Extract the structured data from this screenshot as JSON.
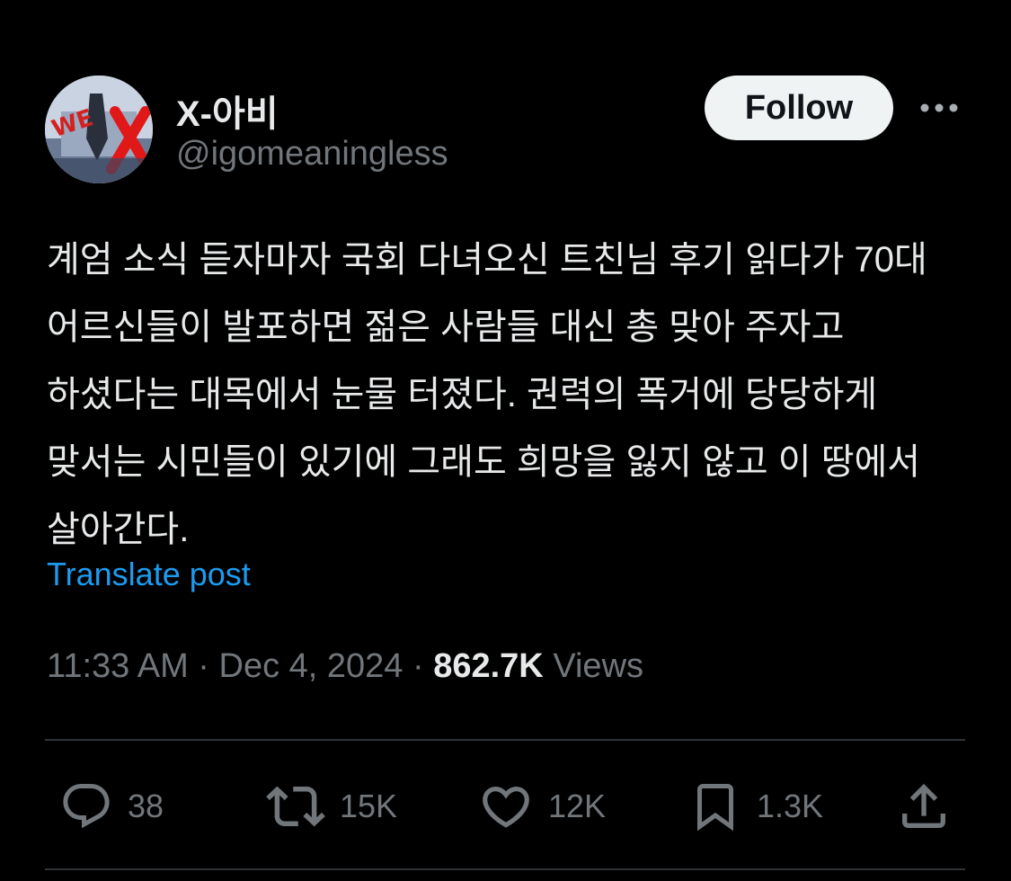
{
  "author": {
    "display_name": "X-아비",
    "handle": "@igomeaningless",
    "avatar_icon": "profile-avatar-image"
  },
  "header": {
    "follow_label": "Follow",
    "more_icon": "more-options-icon"
  },
  "post": {
    "text": "계엄 소식 듣자마자 국회 다녀오신 트친님 후기 읽다가 70대 어르신들이 발포하면 젊은 사람들 대신 총 맞아 주자고 하셨다는 대목에서 눈물 터졌다. 권력의 폭거에 당당하게 맞서는 시민들이 있기에 그래도 희망을 잃지 않고 이 땅에서 살아간다.",
    "translate_label": "Translate post"
  },
  "meta": {
    "time": "11:33 AM",
    "separator": "·",
    "date": "Dec 4, 2024",
    "views_count": "862.7K",
    "views_label": "Views"
  },
  "actions": {
    "replies": "38",
    "reposts": "15K",
    "likes": "12K",
    "bookmarks": "1.3K"
  },
  "colors": {
    "background": "#000000",
    "primary_text": "#e7e9ea",
    "secondary_text": "#71767b",
    "link": "#1d9bf0",
    "follow_button_bg": "#eff3f4",
    "divider": "#2f3336"
  }
}
